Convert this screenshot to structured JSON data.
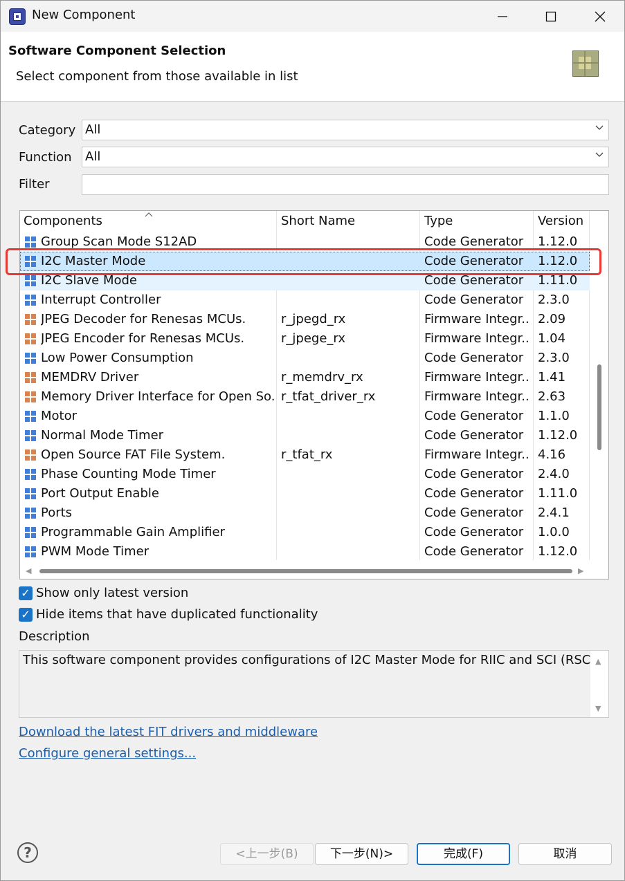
{
  "window": {
    "title": "New Component"
  },
  "header": {
    "title": "Software Component Selection",
    "subtitle": "Select component from those available in list"
  },
  "form": {
    "category_label": "Category",
    "category_value": "All",
    "function_label": "Function",
    "function_value": "All",
    "filter_label": "Filter",
    "filter_value": ""
  },
  "table": {
    "columns": [
      "Components",
      "Short Name",
      "Type",
      "Version"
    ],
    "rows": [
      {
        "icon": "code-generator-icon",
        "name": "Group Scan Mode S12AD",
        "short": "",
        "type": "Code Generator",
        "version": "1.12.0"
      },
      {
        "icon": "code-generator-icon",
        "name": "I2C Master Mode",
        "short": "",
        "type": "Code Generator",
        "version": "1.12.0"
      },
      {
        "icon": "code-generator-icon",
        "name": "I2C Slave Mode",
        "short": "",
        "type": "Code Generator",
        "version": "1.11.0"
      },
      {
        "icon": "code-generator-icon",
        "name": "Interrupt Controller",
        "short": "",
        "type": "Code Generator",
        "version": "2.3.0"
      },
      {
        "icon": "fit-module-icon",
        "name": "JPEG Decoder for Renesas MCUs.",
        "short": "r_jpegd_rx",
        "type": "Firmware Integr...",
        "version": "2.09"
      },
      {
        "icon": "fit-module-icon",
        "name": "JPEG Encoder for Renesas MCUs.",
        "short": "r_jpege_rx",
        "type": "Firmware Integr...",
        "version": "1.04"
      },
      {
        "icon": "code-generator-icon",
        "name": "Low Power Consumption",
        "short": "",
        "type": "Code Generator",
        "version": "2.3.0"
      },
      {
        "icon": "fit-module-icon",
        "name": "MEMDRV Driver",
        "short": "r_memdrv_rx",
        "type": "Firmware Integr...",
        "version": "1.41"
      },
      {
        "icon": "fit-module-icon",
        "name": "Memory Driver Interface for Open So...",
        "short": "r_tfat_driver_rx",
        "type": "Firmware Integr...",
        "version": "2.63"
      },
      {
        "icon": "code-generator-icon",
        "name": "Motor",
        "short": "",
        "type": "Code Generator",
        "version": "1.1.0"
      },
      {
        "icon": "code-generator-icon",
        "name": "Normal Mode Timer",
        "short": "",
        "type": "Code Generator",
        "version": "1.12.0"
      },
      {
        "icon": "fit-module-icon",
        "name": "Open Source FAT File System.",
        "short": "r_tfat_rx",
        "type": "Firmware Integr...",
        "version": "4.16"
      },
      {
        "icon": "code-generator-icon",
        "name": "Phase Counting Mode Timer",
        "short": "",
        "type": "Code Generator",
        "version": "2.4.0"
      },
      {
        "icon": "code-generator-icon",
        "name": "Port Output Enable",
        "short": "",
        "type": "Code Generator",
        "version": "1.11.0"
      },
      {
        "icon": "code-generator-icon",
        "name": "Ports",
        "short": "",
        "type": "Code Generator",
        "version": "2.4.1"
      },
      {
        "icon": "code-generator-icon",
        "name": "Programmable Gain Amplifier",
        "short": "",
        "type": "Code Generator",
        "version": "1.0.0"
      },
      {
        "icon": "code-generator-icon",
        "name": "PWM Mode Timer",
        "short": "",
        "type": "Code Generator",
        "version": "1.12.0"
      }
    ],
    "selected_index": 1,
    "hover_index": 2
  },
  "options": {
    "latest_label": "Show only latest version",
    "latest_checked": true,
    "dup_label": "Hide items that have duplicated functionality",
    "dup_checked": true
  },
  "description": {
    "label": "Description",
    "text": "This software component provides configurations of I2C Master Mode for RIIC and SCI (RSCI)."
  },
  "links": {
    "download": "Download the latest FIT drivers and middleware",
    "configure": "Configure general settings..."
  },
  "buttons": {
    "back": "<上一步(B)",
    "next": "下一步(N)>",
    "finish": "完成(F)",
    "cancel": "取消"
  },
  "colors": {
    "selection": "#cce8ff",
    "highlight_box": "#e53935",
    "link": "#1a5dab",
    "checkbox": "#1a73c7"
  }
}
